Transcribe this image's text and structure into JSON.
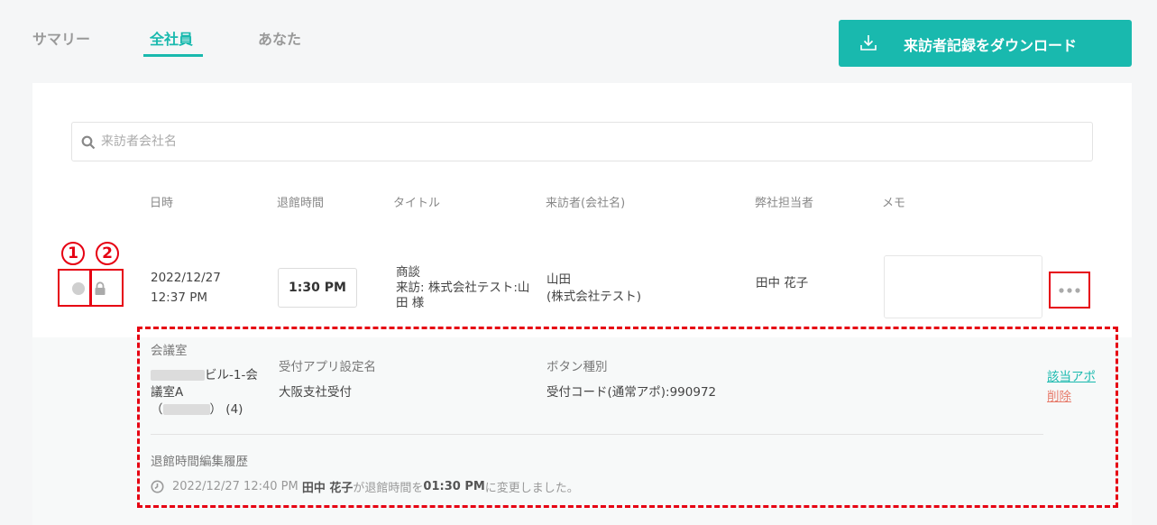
{
  "tabs": [
    {
      "label": "サマリー",
      "active": false
    },
    {
      "label": "全社員",
      "active": true
    },
    {
      "label": "あなた",
      "active": false
    }
  ],
  "download_button": {
    "label": "来訪者記録をダウンロード",
    "icon": "download-icon"
  },
  "search": {
    "placeholder": "来訪者会社名",
    "value": "",
    "icon": "search-icon"
  },
  "columns": [
    "日時",
    "退館時間",
    "タイトル",
    "来訪者(会社名)",
    "弊社担当者",
    "メモ"
  ],
  "row": {
    "date": "2022/12/27",
    "time": "12:37 PM",
    "leave_time": "1:30 PM",
    "title_lines": [
      "商談",
      "来訪: 株式会社テスト:山",
      "田 様"
    ],
    "visitor_lines": [
      "山田",
      "(株式会社テスト)"
    ],
    "staff": "田中 花子",
    "memo": "",
    "status_icon": "dot-icon",
    "lock_icon": "lock-icon"
  },
  "annotations": [
    "1",
    "2"
  ],
  "detail": {
    "room_label": "会議室",
    "room_line1_suffix": "ビル-1-会",
    "room_line2": "議室A",
    "room_line3_open": "（",
    "room_line3_close": "）",
    "room_capacity": "(4)",
    "app_label": "受付アプリ設定名",
    "app_value": "大阪支社受付",
    "button_label": "ボタン種別",
    "button_value": "受付コード(通常アポ):990972",
    "link_appo": "該当アポ",
    "link_delete": "削除",
    "history_label": "退館時間編集履歴",
    "history": {
      "timestamp": "2022/12/27 12:40 PM",
      "user": "田中 花子",
      "text1": "が退館時間を",
      "new_time": "01:30 PM",
      "text2": "に変更しました。"
    }
  },
  "colors": {
    "accent": "#19b9ae",
    "annotation": "#e60012",
    "delete": "#e77b6b"
  }
}
